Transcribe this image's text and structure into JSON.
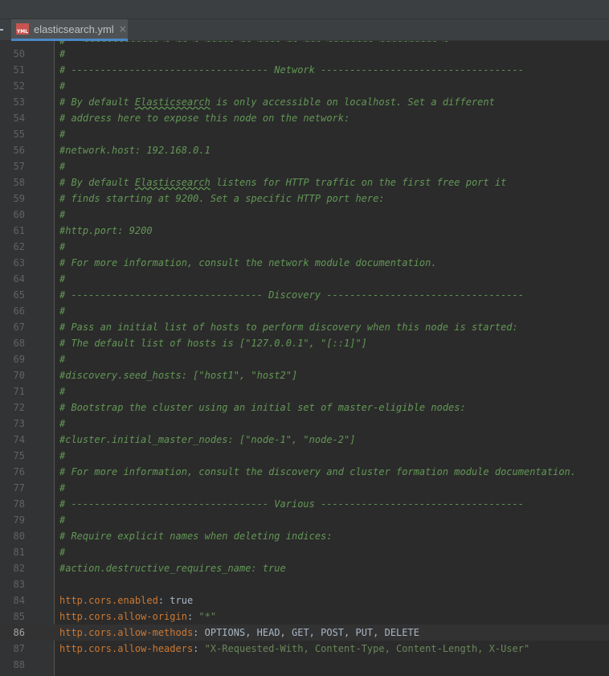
{
  "tab": {
    "icon_label": "YML",
    "title": "elasticsearch.yml",
    "close": "×"
  },
  "editor": {
    "current_line": "86",
    "partial_top_text": "#   ~~~~~~~~~~~~~ ~ ~~ ~ ~~~~~ ~~ ~~~~ ~~ ~~~ ~~~~~~~~ ~~~~~~~~~~ ~",
    "lines": [
      {
        "n": "50",
        "k": "comment",
        "text": "#"
      },
      {
        "n": "51",
        "k": "comment",
        "text": "# ---------------------------------- Network -----------------------------------"
      },
      {
        "n": "52",
        "k": "comment",
        "text": "#"
      },
      {
        "n": "53",
        "k": "comment_es",
        "pre": "# By default ",
        "u": "Elasticsearch",
        "post": " is only accessible on localhost. Set a different"
      },
      {
        "n": "54",
        "k": "comment",
        "text": "# address here to expose this node on the network:"
      },
      {
        "n": "55",
        "k": "comment",
        "text": "#"
      },
      {
        "n": "56",
        "k": "comment",
        "text": "#network.host: 192.168.0.1"
      },
      {
        "n": "57",
        "k": "comment",
        "text": "#"
      },
      {
        "n": "58",
        "k": "comment_es",
        "pre": "# By default ",
        "u": "Elasticsearch",
        "post": " listens for HTTP traffic on the first free port it"
      },
      {
        "n": "59",
        "k": "comment",
        "text": "# finds starting at 9200. Set a specific HTTP port here:"
      },
      {
        "n": "60",
        "k": "comment",
        "text": "#"
      },
      {
        "n": "61",
        "k": "comment",
        "text": "#http.port: 9200"
      },
      {
        "n": "62",
        "k": "comment",
        "text": "#"
      },
      {
        "n": "63",
        "k": "comment",
        "text": "# For more information, consult the network module documentation."
      },
      {
        "n": "64",
        "k": "comment",
        "text": "#"
      },
      {
        "n": "65",
        "k": "comment",
        "text": "# --------------------------------- Discovery ----------------------------------"
      },
      {
        "n": "66",
        "k": "comment",
        "text": "#"
      },
      {
        "n": "67",
        "k": "comment",
        "text": "# Pass an initial list of hosts to perform discovery when this node is started:"
      },
      {
        "n": "68",
        "k": "comment",
        "text": "# The default list of hosts is [\"127.0.0.1\", \"[::1]\"]"
      },
      {
        "n": "69",
        "k": "comment",
        "text": "#"
      },
      {
        "n": "70",
        "k": "comment",
        "text": "#discovery.seed_hosts: [\"host1\", \"host2\"]"
      },
      {
        "n": "71",
        "k": "comment",
        "text": "#"
      },
      {
        "n": "72",
        "k": "comment",
        "text": "# Bootstrap the cluster using an initial set of master-eligible nodes:"
      },
      {
        "n": "73",
        "k": "comment",
        "text": "#"
      },
      {
        "n": "74",
        "k": "comment",
        "text": "#cluster.initial_master_nodes: [\"node-1\", \"node-2\"]"
      },
      {
        "n": "75",
        "k": "comment",
        "text": "#"
      },
      {
        "n": "76",
        "k": "comment",
        "text": "# For more information, consult the discovery and cluster formation module documentation."
      },
      {
        "n": "77",
        "k": "comment",
        "text": "#"
      },
      {
        "n": "78",
        "k": "comment",
        "text": "# ---------------------------------- Various -----------------------------------"
      },
      {
        "n": "79",
        "k": "comment",
        "text": "#"
      },
      {
        "n": "80",
        "k": "comment",
        "text": "# Require explicit names when deleting indices:"
      },
      {
        "n": "81",
        "k": "comment",
        "text": "#"
      },
      {
        "n": "82",
        "k": "comment",
        "text": "#action.destructive_requires_name: true"
      },
      {
        "n": "83",
        "k": "blank",
        "text": ""
      },
      {
        "n": "84",
        "k": "kv",
        "key": "http.cors.enabled",
        "sep": ": ",
        "val": "true",
        "vk": "val"
      },
      {
        "n": "85",
        "k": "kv",
        "key": "http.cors.allow-origin",
        "sep": ": ",
        "val": "\"*\"",
        "vk": "str"
      },
      {
        "n": "86",
        "k": "kv",
        "key": "http.cors.allow-methods",
        "sep": ": ",
        "val": "OPTIONS, HEAD, GET, POST, PUT, DELETE",
        "vk": "val"
      },
      {
        "n": "87",
        "k": "kv",
        "key": "http.cors.allow-headers",
        "sep": ": ",
        "val": "\"X-Requested-With, Content-Type, Content-Length, X-User\"",
        "vk": "str"
      },
      {
        "n": "88",
        "k": "blank",
        "text": ""
      }
    ]
  }
}
